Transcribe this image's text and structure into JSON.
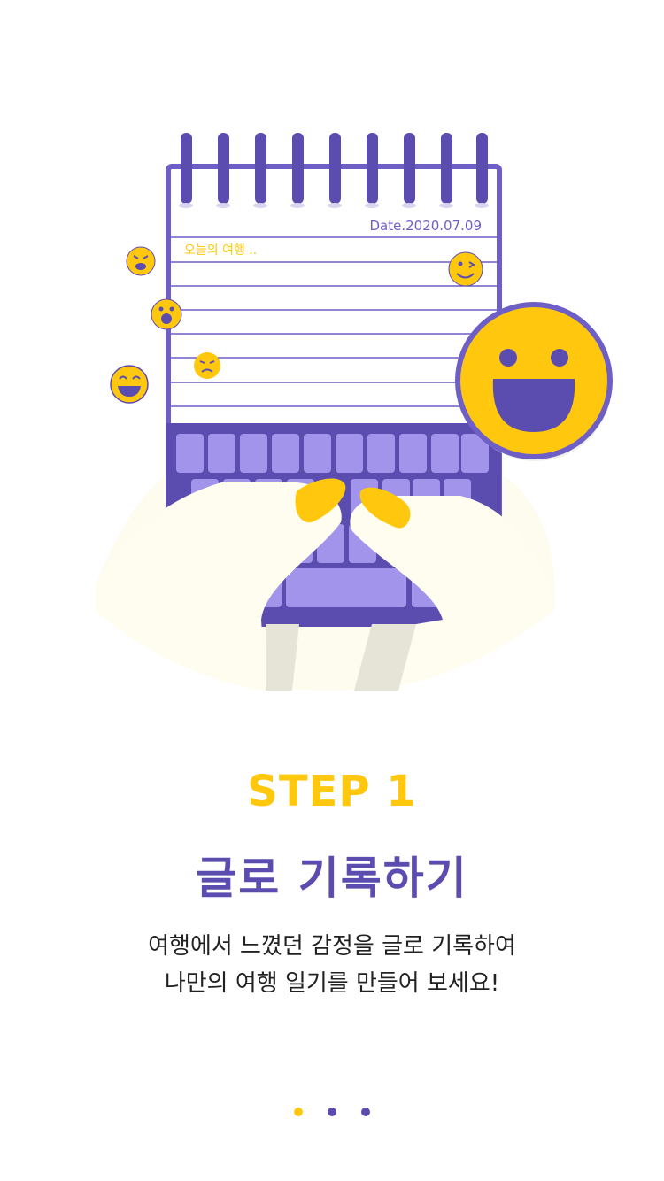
{
  "illustration": {
    "diary_date": "Date.2020.07.09",
    "diary_first_line": "오늘의 여행 .."
  },
  "onboarding": {
    "step_label": "STEP 1",
    "title": "글로 기록하기",
    "description_lines": [
      "여행에서 느꼈던 감정을 글로 기록하여",
      "나만의 여행 일기를 만들어 보세요!"
    ]
  },
  "pagination": {
    "total": 3,
    "active_index": 0
  },
  "colors": {
    "accent_yellow": "#FFC80E",
    "brand_purple": "#5B4CB0",
    "keyboard_key": "#A194EA"
  },
  "icons": [
    "spiral-notebook-icon",
    "keyboard-icon",
    "emoji-grin-icon",
    "emoji-wink-icon",
    "emoji-angry-icon",
    "emoji-surprised-icon",
    "emoji-unamused-icon",
    "emoji-laugh-icon"
  ]
}
